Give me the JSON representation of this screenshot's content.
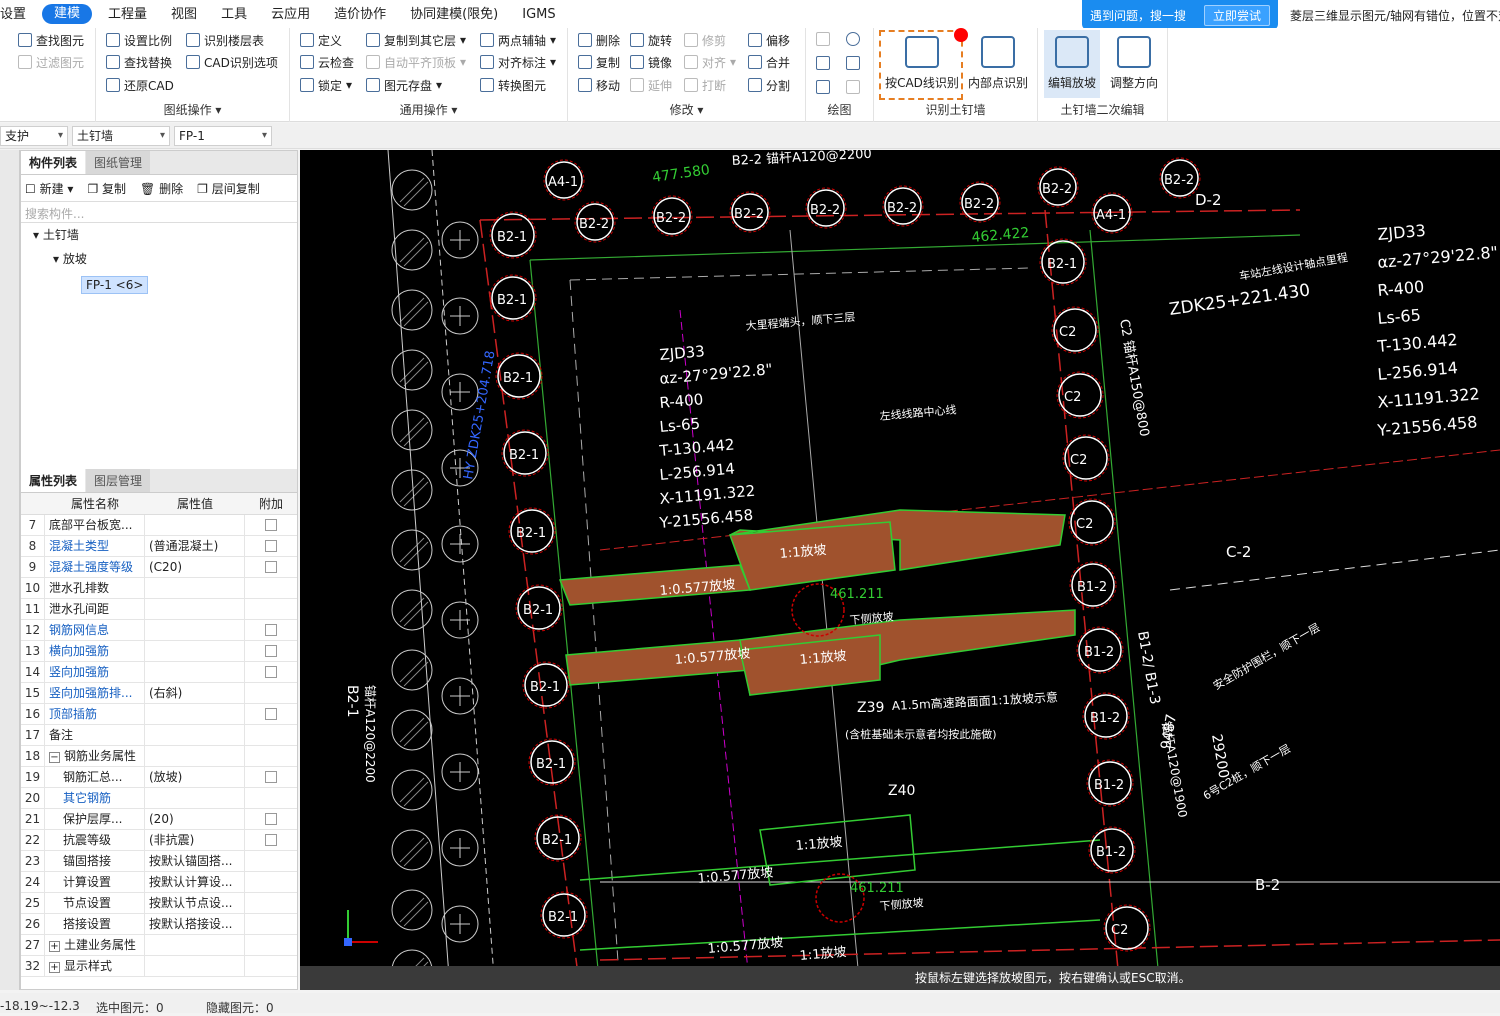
{
  "menu": [
    "设置",
    "建模",
    "工程量",
    "视图",
    "工具",
    "云应用",
    "造价协作",
    "协同建模(限免)",
    "IGMS"
  ],
  "menu_active": "建模",
  "help": {
    "text": "遇到问题，搜一搜",
    "button": "立即尝试"
  },
  "notice": "菱层三维显示图元/轴网有错位，位置不对",
  "ribbon": {
    "drawing_ops": {
      "label": "图纸操作",
      "items": [
        "查找图元",
        "过滤图元",
        "设置比例",
        "查找替换",
        "还原CAD",
        "识别楼层表",
        "CAD识别选项"
      ]
    },
    "general_ops": {
      "label": "通用操作",
      "items": [
        "定义",
        "云检查",
        "锁定",
        "复制到其它层",
        "自动平齐顶板",
        "图元存盘",
        "两点辅轴",
        "对齐标注",
        "转换图元"
      ]
    },
    "modify": {
      "label": "修改",
      "items": [
        "删除",
        "复制",
        "移动",
        "旋转",
        "镜像",
        "延伸",
        "修剪",
        "对齐",
        "打断",
        "偏移",
        "合并",
        "分割"
      ]
    },
    "draw": {
      "label": "绘图"
    },
    "identify": {
      "label": "识别土钉墙",
      "btn1": "按CAD线识别",
      "btn2": "内部点识别"
    },
    "edit2": {
      "label": "土钉墙二次编辑",
      "btn1": "编辑放坡",
      "btn2": "调整方向"
    }
  },
  "selectors": [
    "支护",
    "土钉墙",
    "FP-1"
  ],
  "component_panel": {
    "tabs": [
      "构件列表",
      "图纸管理"
    ],
    "tools": [
      "新建",
      "复制",
      "删除",
      "层间复制"
    ],
    "search_placeholder": "搜索构件...",
    "tree": {
      "root": "土钉墙",
      "child": "放坡",
      "leaf": "FP-1 <6>"
    }
  },
  "property_panel": {
    "tabs": [
      "属性列表",
      "图层管理"
    ],
    "headers": [
      "属性名称",
      "属性值",
      "附加"
    ],
    "rows": [
      {
        "n": "7",
        "name": "底部平台板宽...",
        "val": "",
        "cb": true,
        "blue": false,
        "indent": 0
      },
      {
        "n": "8",
        "name": "混凝土类型",
        "val": "(普通混凝土)",
        "cb": true,
        "blue": true,
        "indent": 0
      },
      {
        "n": "9",
        "name": "混凝土强度等级",
        "val": "(C20)",
        "cb": true,
        "blue": true,
        "indent": 0
      },
      {
        "n": "10",
        "name": "泄水孔排数",
        "val": "",
        "cb": false,
        "blue": false,
        "indent": 0
      },
      {
        "n": "11",
        "name": "泄水孔间距",
        "val": "",
        "cb": false,
        "blue": false,
        "indent": 0
      },
      {
        "n": "12",
        "name": "钢筋网信息",
        "val": "",
        "cb": true,
        "blue": true,
        "indent": 0
      },
      {
        "n": "13",
        "name": "横向加强筋",
        "val": "",
        "cb": true,
        "blue": true,
        "indent": 0
      },
      {
        "n": "14",
        "name": "竖向加强筋",
        "val": "",
        "cb": true,
        "blue": true,
        "indent": 0
      },
      {
        "n": "15",
        "name": "竖向加强筋排...",
        "val": "(右斜)",
        "cb": false,
        "blue": true,
        "indent": 0
      },
      {
        "n": "16",
        "name": "顶部插筋",
        "val": "",
        "cb": true,
        "blue": true,
        "indent": 0
      },
      {
        "n": "17",
        "name": "备注",
        "val": "",
        "cb": false,
        "blue": false,
        "indent": 0
      },
      {
        "n": "18",
        "name": "钢筋业务属性",
        "val": "",
        "cb": false,
        "blue": false,
        "indent": 0,
        "expand": "−"
      },
      {
        "n": "19",
        "name": "钢筋汇总...",
        "val": "(放坡)",
        "cb": true,
        "blue": false,
        "indent": 1
      },
      {
        "n": "20",
        "name": "其它钢筋",
        "val": "",
        "cb": false,
        "blue": true,
        "indent": 1
      },
      {
        "n": "21",
        "name": "保护层厚...",
        "val": "(20)",
        "cb": true,
        "blue": false,
        "indent": 1
      },
      {
        "n": "22",
        "name": "抗震等级",
        "val": "(非抗震)",
        "cb": true,
        "blue": false,
        "indent": 1
      },
      {
        "n": "23",
        "name": "锚固搭接",
        "val": "按默认锚固搭...",
        "cb": false,
        "blue": false,
        "indent": 1
      },
      {
        "n": "24",
        "name": "计算设置",
        "val": "按默认计算设...",
        "cb": false,
        "blue": false,
        "indent": 1
      },
      {
        "n": "25",
        "name": "节点设置",
        "val": "按默认节点设...",
        "cb": false,
        "blue": false,
        "indent": 1
      },
      {
        "n": "26",
        "name": "搭接设置",
        "val": "按默认搭接设...",
        "cb": false,
        "blue": false,
        "indent": 1
      },
      {
        "n": "27",
        "name": "土建业务属性",
        "val": "",
        "cb": false,
        "blue": false,
        "indent": 0,
        "expand": "+"
      },
      {
        "n": "32",
        "name": "显示样式",
        "val": "",
        "cb": false,
        "blue": false,
        "indent": 0,
        "expand": "+"
      }
    ]
  },
  "cad": {
    "left_piles": [
      "B2-1",
      "B2-1",
      "B2-1",
      "B2-1",
      "B2-1",
      "B2-1",
      "B2-1",
      "B2-1",
      "B2-1",
      "B2-1"
    ],
    "top_piles": [
      "A4-1",
      "B2-2",
      "B2-2",
      "B2-2",
      "B2-2",
      "B2-2",
      "B2-2",
      "B2-2",
      "B2-2",
      "A4-1"
    ],
    "right_piles": [
      "B2-1",
      "C2",
      "C2",
      "C2",
      "C2",
      "B1-2",
      "B1-2",
      "B1-2",
      "B1-2",
      "B1-2",
      "C2"
    ],
    "curve_left": [
      "ZJD33",
      "αz-27°29'22.8\"",
      "R-400",
      "Ls-65",
      "T-130.442",
      "L-256.914",
      "X-11191.322",
      "Y-21556.458"
    ],
    "curve_right": [
      "ZJD33",
      "αz-27°29'22.8\"",
      "R-400",
      "Ls-65",
      "T-130.442",
      "L-256.914",
      "X-11191.322",
      "Y-21556.458"
    ],
    "labels": {
      "l477": "477.580",
      "l462": "462.422",
      "zdk": "ZDK25+221.430",
      "d2": "D-2",
      "c2": "C-2",
      "b2": "B-2",
      "slope1": "1:1放坡",
      "slope0577": "1:0.577放坡",
      "e461": "461.211",
      "xia": "下侧放坡",
      "z39": "Z39",
      "a15": "A1.5m高速路面面1:1放坡示意",
      "a15b": "(含桩基础未示意者均按此施做)",
      "z40": "Z40",
      "b2side": "B2-1",
      "b2sidesub": "锚杆A120@2200",
      "hy": "HY ZDK25+204.718",
      "right1": "B1-2/ B1-3",
      "right2": "锚杆A120@1900",
      "n9487": "9487",
      "n29200": "29200",
      "rc1": "安全防护围栏，顺下一层",
      "rc2": "6号C2桩，顺下一层",
      "topnote": "B2-2 锚杆A120@2200",
      "cn1": "大里程端头，顺下三层",
      "cn2": "左线线路中心线",
      "cn3": "车站左线设计轴点里程",
      "c2v": "C2 锚杆A150@800"
    }
  },
  "status_hint": "按鼠标左键选择放坡图元，按右键确认或ESC取消。",
  "statusbar": {
    "coord": "-18.19~-12.3",
    "selected": "选中图元：0",
    "hidden": "隐藏图元：0"
  }
}
